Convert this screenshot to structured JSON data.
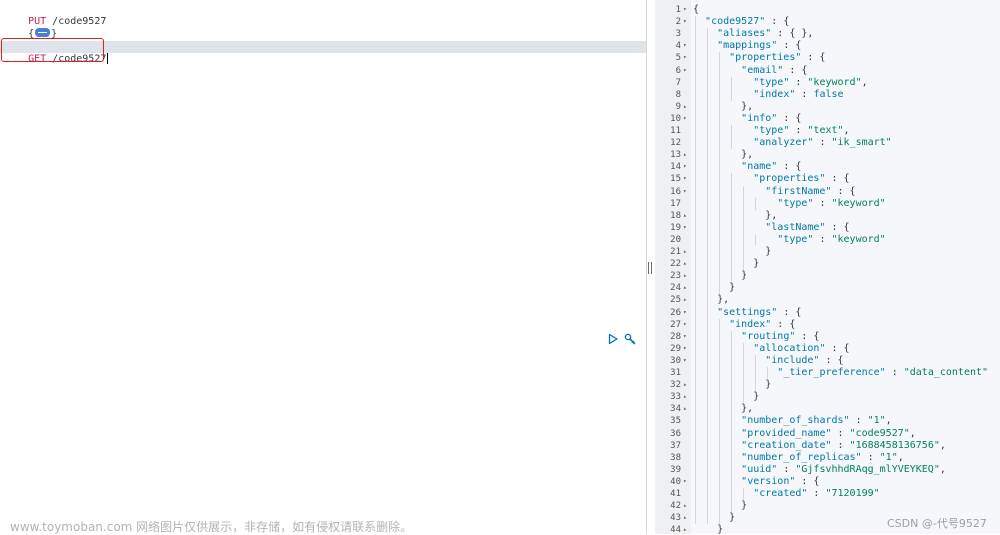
{
  "request_editor": {
    "line1_method": "PUT",
    "line1_path": " /code9527",
    "line2_open": "{",
    "line2_close": "}",
    "line3_method": "GET",
    "line3_path": " /code9527"
  },
  "actions": {
    "run_icon": "play-icon",
    "settings_icon": "wrench-icon"
  },
  "watermark": "www.toymoban.com 网络图片仅供展示，非存储，如有侵权请联系删除。",
  "csdn_watermark": "CSDN @-代号9527",
  "response": {
    "lines": [
      {
        "n": "1",
        "f": "▾",
        "t": [
          {
            "c": "p",
            "v": "{"
          }
        ]
      },
      {
        "n": "2",
        "f": "▾",
        "t": [
          {
            "c": "p",
            "v": "  "
          },
          {
            "c": "k",
            "v": "\"code9527\""
          },
          {
            "c": "p",
            "v": " : {"
          }
        ]
      },
      {
        "n": "3",
        "f": "",
        "t": [
          {
            "c": "p",
            "v": "    "
          },
          {
            "c": "k",
            "v": "\"aliases\""
          },
          {
            "c": "p",
            "v": " : { },"
          }
        ]
      },
      {
        "n": "4",
        "f": "▾",
        "t": [
          {
            "c": "p",
            "v": "    "
          },
          {
            "c": "k",
            "v": "\"mappings\""
          },
          {
            "c": "p",
            "v": " : {"
          }
        ]
      },
      {
        "n": "5",
        "f": "▾",
        "t": [
          {
            "c": "p",
            "v": "      "
          },
          {
            "c": "k",
            "v": "\"properties\""
          },
          {
            "c": "p",
            "v": " : {"
          }
        ]
      },
      {
        "n": "6",
        "f": "▾",
        "t": [
          {
            "c": "p",
            "v": "        "
          },
          {
            "c": "k",
            "v": "\"email\""
          },
          {
            "c": "p",
            "v": " : {"
          }
        ]
      },
      {
        "n": "7",
        "f": "",
        "t": [
          {
            "c": "p",
            "v": "          "
          },
          {
            "c": "k",
            "v": "\"type\""
          },
          {
            "c": "p",
            "v": " : "
          },
          {
            "c": "s",
            "v": "\"keyword\""
          },
          {
            "c": "p",
            "v": ","
          }
        ]
      },
      {
        "n": "8",
        "f": "",
        "t": [
          {
            "c": "p",
            "v": "          "
          },
          {
            "c": "k",
            "v": "\"index\""
          },
          {
            "c": "p",
            "v": " : "
          },
          {
            "c": "v",
            "v": "false"
          }
        ]
      },
      {
        "n": "9",
        "f": "▴",
        "t": [
          {
            "c": "p",
            "v": "        },"
          }
        ]
      },
      {
        "n": "10",
        "f": "▾",
        "t": [
          {
            "c": "p",
            "v": "        "
          },
          {
            "c": "k",
            "v": "\"info\""
          },
          {
            "c": "p",
            "v": " : {"
          }
        ]
      },
      {
        "n": "11",
        "f": "",
        "t": [
          {
            "c": "p",
            "v": "          "
          },
          {
            "c": "k",
            "v": "\"type\""
          },
          {
            "c": "p",
            "v": " : "
          },
          {
            "c": "s",
            "v": "\"text\""
          },
          {
            "c": "p",
            "v": ","
          }
        ]
      },
      {
        "n": "12",
        "f": "",
        "t": [
          {
            "c": "p",
            "v": "          "
          },
          {
            "c": "k",
            "v": "\"analyzer\""
          },
          {
            "c": "p",
            "v": " : "
          },
          {
            "c": "s",
            "v": "\"ik_smart\""
          }
        ]
      },
      {
        "n": "13",
        "f": "▴",
        "t": [
          {
            "c": "p",
            "v": "        },"
          }
        ]
      },
      {
        "n": "14",
        "f": "▾",
        "t": [
          {
            "c": "p",
            "v": "        "
          },
          {
            "c": "k",
            "v": "\"name\""
          },
          {
            "c": "p",
            "v": " : {"
          }
        ]
      },
      {
        "n": "15",
        "f": "▾",
        "t": [
          {
            "c": "p",
            "v": "          "
          },
          {
            "c": "k",
            "v": "\"properties\""
          },
          {
            "c": "p",
            "v": " : {"
          }
        ]
      },
      {
        "n": "16",
        "f": "▾",
        "t": [
          {
            "c": "p",
            "v": "            "
          },
          {
            "c": "k",
            "v": "\"firstName\""
          },
          {
            "c": "p",
            "v": " : {"
          }
        ]
      },
      {
        "n": "17",
        "f": "",
        "t": [
          {
            "c": "p",
            "v": "              "
          },
          {
            "c": "k",
            "v": "\"type\""
          },
          {
            "c": "p",
            "v": " : "
          },
          {
            "c": "s",
            "v": "\"keyword\""
          }
        ]
      },
      {
        "n": "18",
        "f": "▴",
        "t": [
          {
            "c": "p",
            "v": "            },"
          }
        ]
      },
      {
        "n": "19",
        "f": "▾",
        "t": [
          {
            "c": "p",
            "v": "            "
          },
          {
            "c": "k",
            "v": "\"lastName\""
          },
          {
            "c": "p",
            "v": " : {"
          }
        ]
      },
      {
        "n": "20",
        "f": "",
        "t": [
          {
            "c": "p",
            "v": "              "
          },
          {
            "c": "k",
            "v": "\"type\""
          },
          {
            "c": "p",
            "v": " : "
          },
          {
            "c": "s",
            "v": "\"keyword\""
          }
        ]
      },
      {
        "n": "21",
        "f": "▴",
        "t": [
          {
            "c": "p",
            "v": "            }"
          }
        ]
      },
      {
        "n": "22",
        "f": "▴",
        "t": [
          {
            "c": "p",
            "v": "          }"
          }
        ]
      },
      {
        "n": "23",
        "f": "▴",
        "t": [
          {
            "c": "p",
            "v": "        }"
          }
        ]
      },
      {
        "n": "24",
        "f": "▴",
        "t": [
          {
            "c": "p",
            "v": "      }"
          }
        ]
      },
      {
        "n": "25",
        "f": "▴",
        "t": [
          {
            "c": "p",
            "v": "    },"
          }
        ]
      },
      {
        "n": "26",
        "f": "▾",
        "t": [
          {
            "c": "p",
            "v": "    "
          },
          {
            "c": "k",
            "v": "\"settings\""
          },
          {
            "c": "p",
            "v": " : {"
          }
        ]
      },
      {
        "n": "27",
        "f": "▾",
        "t": [
          {
            "c": "p",
            "v": "      "
          },
          {
            "c": "k",
            "v": "\"index\""
          },
          {
            "c": "p",
            "v": " : {"
          }
        ]
      },
      {
        "n": "28",
        "f": "▾",
        "t": [
          {
            "c": "p",
            "v": "        "
          },
          {
            "c": "k",
            "v": "\"routing\""
          },
          {
            "c": "p",
            "v": " : {"
          }
        ]
      },
      {
        "n": "29",
        "f": "▾",
        "t": [
          {
            "c": "p",
            "v": "          "
          },
          {
            "c": "k",
            "v": "\"allocation\""
          },
          {
            "c": "p",
            "v": " : {"
          }
        ]
      },
      {
        "n": "30",
        "f": "▾",
        "t": [
          {
            "c": "p",
            "v": "            "
          },
          {
            "c": "k",
            "v": "\"include\""
          },
          {
            "c": "p",
            "v": " : {"
          }
        ]
      },
      {
        "n": "31",
        "f": "",
        "t": [
          {
            "c": "p",
            "v": "              "
          },
          {
            "c": "k",
            "v": "\"_tier_preference\""
          },
          {
            "c": "p",
            "v": " : "
          },
          {
            "c": "s",
            "v": "\"data_content\""
          }
        ]
      },
      {
        "n": "32",
        "f": "▴",
        "t": [
          {
            "c": "p",
            "v": "            }"
          }
        ]
      },
      {
        "n": "33",
        "f": "▴",
        "t": [
          {
            "c": "p",
            "v": "          }"
          }
        ]
      },
      {
        "n": "34",
        "f": "▴",
        "t": [
          {
            "c": "p",
            "v": "        },"
          }
        ]
      },
      {
        "n": "35",
        "f": "",
        "t": [
          {
            "c": "p",
            "v": "        "
          },
          {
            "c": "k",
            "v": "\"number_of_shards\""
          },
          {
            "c": "p",
            "v": " : "
          },
          {
            "c": "s",
            "v": "\"1\""
          },
          {
            "c": "p",
            "v": ","
          }
        ]
      },
      {
        "n": "36",
        "f": "",
        "t": [
          {
            "c": "p",
            "v": "        "
          },
          {
            "c": "k",
            "v": "\"provided_name\""
          },
          {
            "c": "p",
            "v": " : "
          },
          {
            "c": "s",
            "v": "\"code9527\""
          },
          {
            "c": "p",
            "v": ","
          }
        ]
      },
      {
        "n": "37",
        "f": "",
        "t": [
          {
            "c": "p",
            "v": "        "
          },
          {
            "c": "k",
            "v": "\"creation_date\""
          },
          {
            "c": "p",
            "v": " : "
          },
          {
            "c": "s",
            "v": "\"1688458136756\""
          },
          {
            "c": "p",
            "v": ","
          }
        ]
      },
      {
        "n": "38",
        "f": "",
        "t": [
          {
            "c": "p",
            "v": "        "
          },
          {
            "c": "k",
            "v": "\"number_of_replicas\""
          },
          {
            "c": "p",
            "v": " : "
          },
          {
            "c": "s",
            "v": "\"1\""
          },
          {
            "c": "p",
            "v": ","
          }
        ]
      },
      {
        "n": "39",
        "f": "",
        "t": [
          {
            "c": "p",
            "v": "        "
          },
          {
            "c": "k",
            "v": "\"uuid\""
          },
          {
            "c": "p",
            "v": " : "
          },
          {
            "c": "s",
            "v": "\"GjfsvhhdRAqg_mlYVEYKEQ\""
          },
          {
            "c": "p",
            "v": ","
          }
        ]
      },
      {
        "n": "40",
        "f": "▾",
        "t": [
          {
            "c": "p",
            "v": "        "
          },
          {
            "c": "k",
            "v": "\"version\""
          },
          {
            "c": "p",
            "v": " : {"
          }
        ]
      },
      {
        "n": "41",
        "f": "",
        "t": [
          {
            "c": "p",
            "v": "          "
          },
          {
            "c": "k",
            "v": "\"created\""
          },
          {
            "c": "p",
            "v": " : "
          },
          {
            "c": "s",
            "v": "\"7120199\""
          }
        ]
      },
      {
        "n": "42",
        "f": "▴",
        "t": [
          {
            "c": "p",
            "v": "        }"
          }
        ]
      },
      {
        "n": "43",
        "f": "▴",
        "t": [
          {
            "c": "p",
            "v": "      }"
          }
        ]
      },
      {
        "n": "44",
        "f": "▴",
        "t": [
          {
            "c": "p",
            "v": "    }"
          }
        ]
      }
    ]
  }
}
